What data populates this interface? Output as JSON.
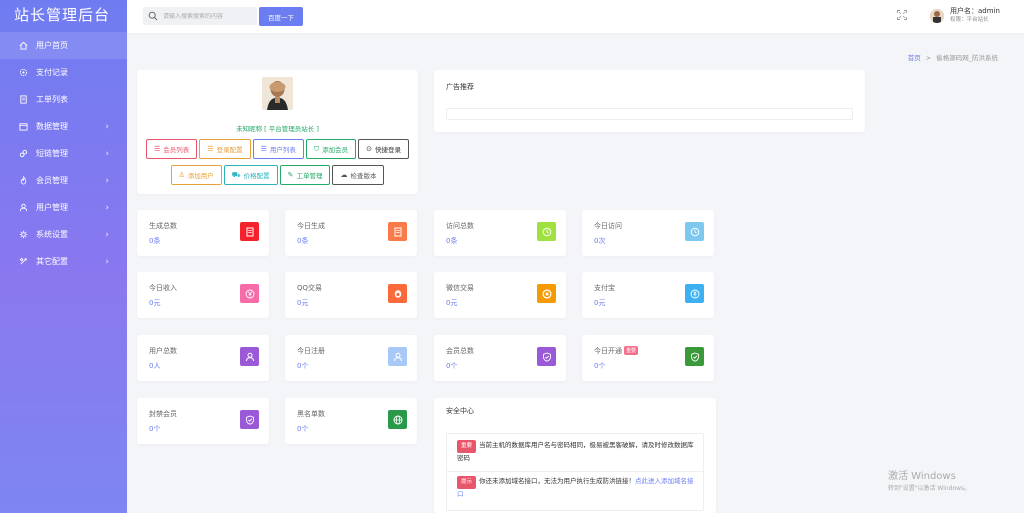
{
  "app": {
    "title": "站长管理后台"
  },
  "sidebar": {
    "items": [
      {
        "label": "用户首页",
        "icon": "home-icon",
        "active": true,
        "arrow": ""
      },
      {
        "label": "支付记录",
        "icon": "gear-icon",
        "arrow": ""
      },
      {
        "label": "工单列表",
        "icon": "doc-icon",
        "arrow": ""
      },
      {
        "label": "数据管理",
        "icon": "calendar-icon",
        "arrow": "›"
      },
      {
        "label": "短链管理",
        "icon": "link-icon",
        "arrow": "›"
      },
      {
        "label": "会员管理",
        "icon": "fire-icon",
        "arrow": "›"
      },
      {
        "label": "用户管理",
        "icon": "user-icon",
        "arrow": "›"
      },
      {
        "label": "系统设置",
        "icon": "settings-icon",
        "arrow": "›"
      },
      {
        "label": "其它配置",
        "icon": "config-icon",
        "arrow": "›"
      }
    ]
  },
  "header": {
    "search_placeholder": "请输入搜索搜索的内容",
    "search_button": "百度一下",
    "user_name": "用户名：admin",
    "user_role": "权限：平台站长"
  },
  "breadcrumb": {
    "home": "首页",
    "sep": ">",
    "current": "偷格源码网_防洪系统"
  },
  "profile": {
    "nickname": "未知昵称 [ 平台管理员站长 ]",
    "buttons_row1": [
      {
        "label": "会员列表",
        "icon": "☰",
        "color": "#e8566c"
      },
      {
        "label": "登录配置",
        "icon": "☰",
        "color": "#e6a23c"
      },
      {
        "label": "用户列表",
        "icon": "☰",
        "color": "#6b7df0"
      },
      {
        "label": "添加会员",
        "icon": "⛉",
        "color": "#22aa66"
      },
      {
        "label": "快捷登录",
        "icon": "⊙",
        "color": "#333333"
      }
    ],
    "buttons_row2": [
      {
        "label": "添加用户",
        "icon": "♙",
        "color": "#e6a23c"
      },
      {
        "label": "价格配置",
        "icon": "⛟",
        "color": "#2bb3c0"
      },
      {
        "label": "工单管理",
        "icon": "✎",
        "color": "#22aa66"
      },
      {
        "label": "检查版本",
        "icon": "☁",
        "color": "#555555"
      }
    ]
  },
  "ad": {
    "title": "广告推荐"
  },
  "stats": [
    {
      "label": "生成总数",
      "value": "0条",
      "color": "#f5222d",
      "icon": "doc-icon"
    },
    {
      "label": "今日生成",
      "value": "0条",
      "color": "#fa7a4a",
      "icon": "doc-icon"
    },
    {
      "label": "访问总数",
      "value": "0条",
      "color": "#a0e040",
      "icon": "clock-icon"
    },
    {
      "label": "今日访问",
      "value": "0次",
      "color": "#7ec8f0",
      "icon": "clock-icon"
    },
    {
      "label": "今日收入",
      "value": "0元",
      "color": "#f56ca8",
      "icon": "yen-icon"
    },
    {
      "label": "QQ交易",
      "value": "0元",
      "color": "#fa6a3a",
      "icon": "qq-icon"
    },
    {
      "label": "微信交易",
      "value": "0元",
      "color": "#f59a00",
      "icon": "wechat-icon"
    },
    {
      "label": "支付宝",
      "value": "0元",
      "color": "#3cb0f0",
      "icon": "alipay-icon"
    },
    {
      "label": "用户总数",
      "value": "0人",
      "color": "#9a5ad8",
      "icon": "user-icon"
    },
    {
      "label": "今日注册",
      "value": "0个",
      "color": "#a8c8f8",
      "icon": "user-icon"
    },
    {
      "label": "会员总数",
      "value": "0个",
      "color": "#9a5ad8",
      "icon": "shield-icon"
    },
    {
      "label": "今日开通",
      "value": "0个",
      "color": "#3a9a3a",
      "icon": "shield-icon",
      "badge": "重要"
    },
    {
      "label": "封禁会员",
      "value": "0个",
      "color": "#9a5ad8",
      "icon": "shield-icon"
    },
    {
      "label": "黑名单数",
      "value": "0个",
      "color": "#2a9a4a",
      "icon": "globe-icon"
    }
  ],
  "security": {
    "title": "安全中心",
    "notice1_tag": "重要",
    "notice1_text": "当前主机的数据库用户名与密码相同，极易被黑客破解，请及时修改数据库密码",
    "notice2_tag": "提示",
    "notice2_text": "你还未添加域名接口，无法为用户执行生成防洪链接！",
    "notice2_link": "点此进入添加域名接口"
  },
  "watermark": {
    "line1": "激活 Windows",
    "line2": "转到\"设置\"以激活 Windows。"
  }
}
